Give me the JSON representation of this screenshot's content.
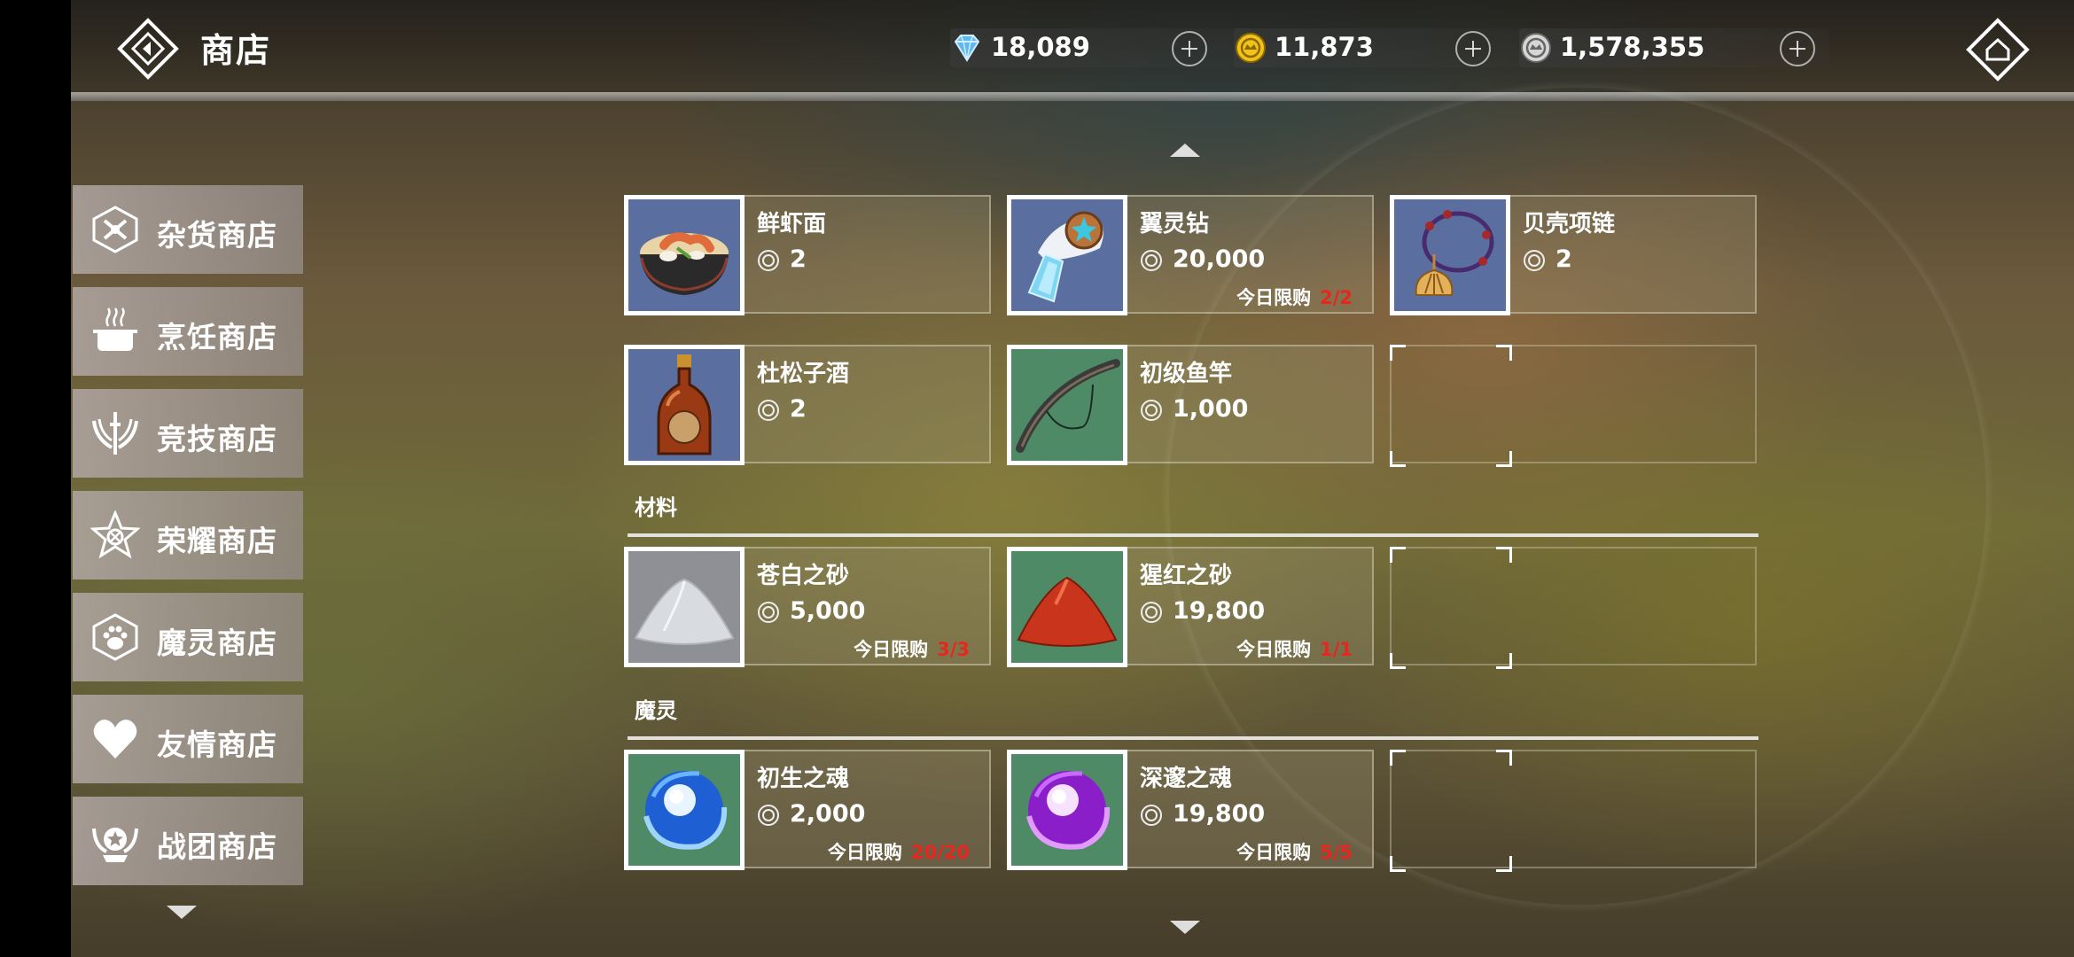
{
  "header": {
    "title": "商店",
    "currencies": [
      {
        "name": "diamond",
        "value": "18,089"
      },
      {
        "name": "gold",
        "value": "11,873"
      },
      {
        "name": "silver",
        "value": "1,578,355"
      }
    ]
  },
  "sidebar": {
    "items": [
      {
        "label": "杂货商店",
        "icon": "grocery-shop-icon"
      },
      {
        "label": "烹饪商店",
        "icon": "cooking-pot-icon"
      },
      {
        "label": "竞技商店",
        "icon": "arena-emblem-icon"
      },
      {
        "label": "荣耀商店",
        "icon": "glory-star-icon"
      },
      {
        "label": "魔灵商店",
        "icon": "paw-icon"
      },
      {
        "label": "友情商店",
        "icon": "heart-icon"
      },
      {
        "label": "战团商店",
        "icon": "guild-star-icon"
      }
    ]
  },
  "shop": {
    "limit_label": "今日限购",
    "rows_top": [
      [
        {
          "name": "鲜虾面",
          "price": "2",
          "limit": ""
        },
        {
          "name": "翼灵钻",
          "price": "20,000",
          "limit": "2/2"
        },
        {
          "name": "贝壳项链",
          "price": "2",
          "limit": ""
        }
      ],
      [
        {
          "name": "杜松子酒",
          "price": "2",
          "limit": ""
        },
        {
          "name": "初级鱼竿",
          "price": "1,000",
          "limit": ""
        }
      ]
    ],
    "sections": [
      {
        "title": "材料",
        "items": [
          {
            "name": "苍白之砂",
            "price": "5,000",
            "limit": "3/3"
          },
          {
            "name": "猩红之砂",
            "price": "19,800",
            "limit": "1/1"
          }
        ]
      },
      {
        "title": "魔灵",
        "items": [
          {
            "name": "初生之魂",
            "price": "2,000",
            "limit": "20/20"
          },
          {
            "name": "深邃之魂",
            "price": "19,800",
            "limit": "5/5"
          }
        ]
      }
    ]
  },
  "colors": {
    "limit_value": "#e8261e",
    "gold_coin": "#f2c21b",
    "diamond": "#5fb8f0"
  }
}
